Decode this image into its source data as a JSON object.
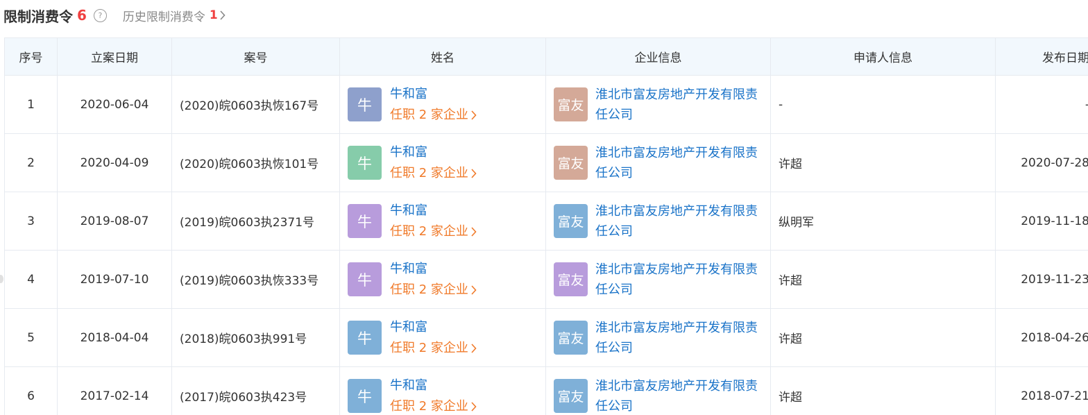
{
  "header": {
    "title": "限制消费令",
    "count": "6",
    "help_glyph": "?",
    "history_label": "历史限制消费令",
    "history_count": "1"
  },
  "columns": [
    "序号",
    "立案日期",
    "案号",
    "姓名",
    "企业信息",
    "申请人信息",
    "发布日期"
  ],
  "rows": [
    {
      "index": "1",
      "date": "2020-06-04",
      "case_no": "(2020)皖0603执恢167号",
      "avatar_text": "牛",
      "avatar_color": "#8ea0cc",
      "person_name": "牛和富",
      "person_link": "任职 2 家企业",
      "company_avatar_text": "富友",
      "company_avatar_color": "#d4a998",
      "company_name": "淮北市富友房地产开发有限责任公司",
      "applicant": "-",
      "publish_date": "-"
    },
    {
      "index": "2",
      "date": "2020-04-09",
      "case_no": "(2020)皖0603执恢101号",
      "avatar_text": "牛",
      "avatar_color": "#86ccaa",
      "person_name": "牛和富",
      "person_link": "任职 2 家企业",
      "company_avatar_text": "富友",
      "company_avatar_color": "#d4a998",
      "company_name": "淮北市富友房地产开发有限责任公司",
      "applicant": "许超",
      "publish_date": "2020-07-28"
    },
    {
      "index": "3",
      "date": "2019-08-07",
      "case_no": "(2019)皖0603执2371号",
      "avatar_text": "牛",
      "avatar_color": "#b89cdc",
      "person_name": "牛和富",
      "person_link": "任职 2 家企业",
      "company_avatar_text": "富友",
      "company_avatar_color": "#7fb0d8",
      "company_name": "淮北市富友房地产开发有限责任公司",
      "applicant": "纵明军",
      "publish_date": "2019-11-18"
    },
    {
      "index": "4",
      "date": "2019-07-10",
      "case_no": "(2019)皖0603执恢333号",
      "avatar_text": "牛",
      "avatar_color": "#b89cdc",
      "person_name": "牛和富",
      "person_link": "任职 2 家企业",
      "company_avatar_text": "富友",
      "company_avatar_color": "#b89cdc",
      "company_name": "淮北市富友房地产开发有限责任公司",
      "applicant": "许超",
      "publish_date": "2019-11-23"
    },
    {
      "index": "5",
      "date": "2018-04-04",
      "case_no": "(2018)皖0603执991号",
      "avatar_text": "牛",
      "avatar_color": "#7fb0d8",
      "person_name": "牛和富",
      "person_link": "任职 2 家企业",
      "company_avatar_text": "富友",
      "company_avatar_color": "#7fb0d8",
      "company_name": "淮北市富友房地产开发有限责任公司",
      "applicant": "许超",
      "publish_date": "2018-04-26"
    },
    {
      "index": "6",
      "date": "2017-02-14",
      "case_no": "(2017)皖0603执423号",
      "avatar_text": "牛",
      "avatar_color": "#7fb0d8",
      "person_name": "牛和富",
      "person_link": "任职 2 家企业",
      "company_avatar_text": "富友",
      "company_avatar_color": "#7fb0d8",
      "company_name": "淮北市富友房地产开发有限责任公司",
      "applicant": "许超",
      "publish_date": "2018-07-21"
    }
  ],
  "icons": {
    "help": "help-icon",
    "history_chevron": "chevron-right-icon",
    "link_chevron": "chevron-right-icon"
  },
  "colors": {
    "accent_red": "#f04040",
    "link_blue": "#1a73c8",
    "link_orange": "#f07a2a",
    "header_bg": "#f2f8fd",
    "border": "#e6eaf0"
  }
}
